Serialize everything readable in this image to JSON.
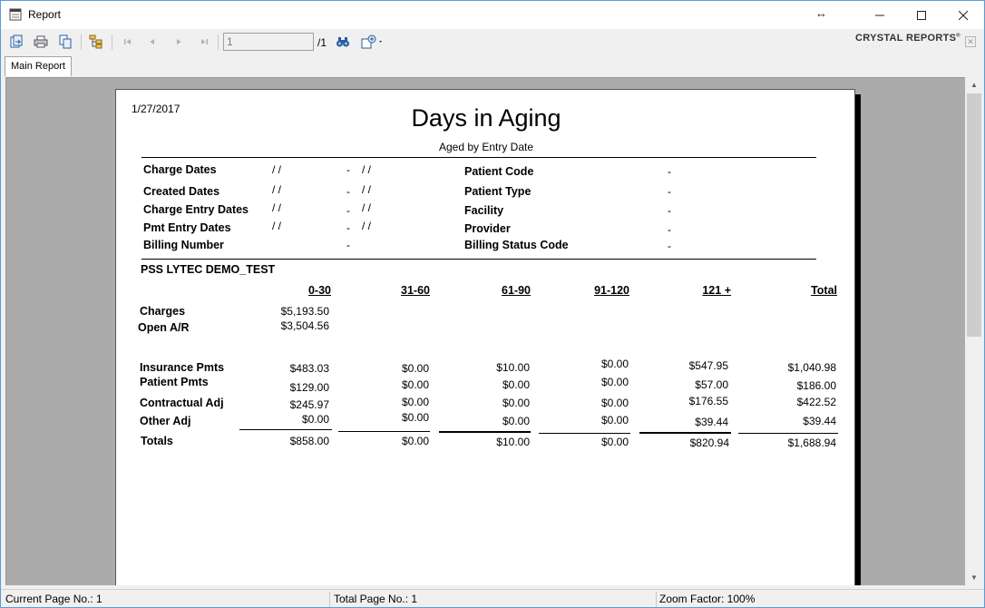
{
  "window": {
    "title": "Report"
  },
  "toolbar": {
    "page_value": "1",
    "page_total": "/1",
    "brand": "CRYSTAL REPORTS",
    "brand_mark": "®"
  },
  "tabs": [
    {
      "label": "Main Report"
    }
  ],
  "report": {
    "date": "1/27/2017",
    "title": "Days in Aging",
    "subtitle": "Aged by Entry Date",
    "criteria_left": [
      {
        "label": "Charge Dates",
        "from": "/ /",
        "sep": "-",
        "to": "/ /"
      },
      {
        "label": "Created Dates",
        "from": "/ /",
        "sep": "-",
        "to": "/ /"
      },
      {
        "label": "Charge Entry Dates",
        "from": "/ /",
        "sep": "-",
        "to": "/ /"
      },
      {
        "label": "Pmt Entry Dates",
        "from": "/ /",
        "sep": "-",
        "to": "/ /"
      },
      {
        "label": "Billing Number",
        "from": "",
        "sep": "-",
        "to": ""
      }
    ],
    "criteria_right": [
      {
        "label": "Patient Code",
        "sep": "-"
      },
      {
        "label": "Patient Type",
        "sep": "-"
      },
      {
        "label": "Facility",
        "sep": "-"
      },
      {
        "label": "Provider",
        "sep": "-"
      },
      {
        "label": "Billing Status Code",
        "sep": "-"
      }
    ],
    "practice": "PSS LYTEC DEMO_TEST",
    "columns": [
      "0-30",
      "31-60",
      "61-90",
      "91-120",
      "121 +",
      "Total"
    ],
    "charges": {
      "label": "Charges",
      "value": "$5,193.50"
    },
    "open_ar": {
      "label": "Open A/R",
      "value": "$3,504.56"
    },
    "rows": [
      {
        "label": "Insurance Pmts",
        "values": [
          "$483.03",
          "$0.00",
          "$10.00",
          "$0.00",
          "$547.95",
          "$1,040.98"
        ]
      },
      {
        "label": "Patient Pmts",
        "values": [
          "$129.00",
          "$0.00",
          "$0.00",
          "$0.00",
          "$57.00",
          "$186.00"
        ]
      },
      {
        "label": "Contractual Adj",
        "values": [
          "$245.97",
          "$0.00",
          "$0.00",
          "$0.00",
          "$176.55",
          "$422.52"
        ]
      },
      {
        "label": "Other Adj",
        "values": [
          "$0.00",
          "$0.00",
          "$0.00",
          "$0.00",
          "$39.44",
          "$39.44"
        ]
      }
    ],
    "totals": {
      "label": "Totals",
      "values": [
        "$858.00",
        "$0.00",
        "$10.00",
        "$0.00",
        "$820.94",
        "$1,688.94"
      ]
    }
  },
  "status": {
    "current_page": "Current Page No.: 1",
    "total_page": "Total Page No.: 1",
    "zoom": "Zoom Factor: 100%"
  }
}
